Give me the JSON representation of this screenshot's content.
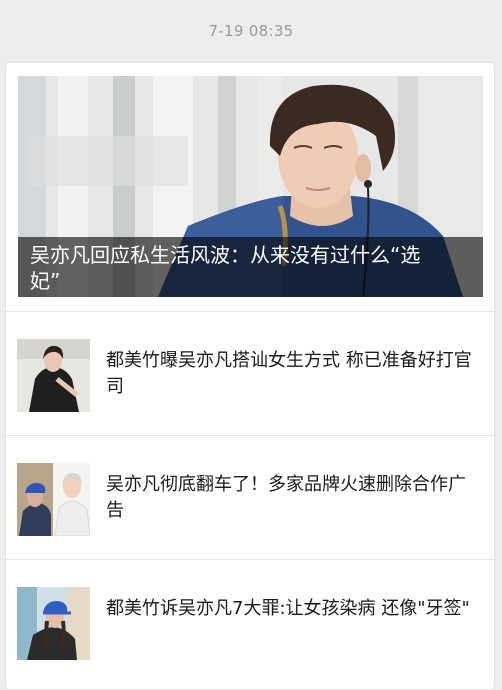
{
  "timestamp": "7-19 08:35",
  "hero": {
    "title": "吴亦凡回应私生活风波：从来没有过什么“选妃”",
    "chevron_icon": "chevron-right-icon"
  },
  "articles": [
    {
      "title": "都美竹曝吴亦凡搭讪女生方式 称已准备好打官司"
    },
    {
      "title": "吴亦凡彻底翻车了！多家品牌火速删除合作广告"
    },
    {
      "title": "都美竹诉吴亦凡7大罪:让女孩染病 还像\"牙签\""
    }
  ]
}
